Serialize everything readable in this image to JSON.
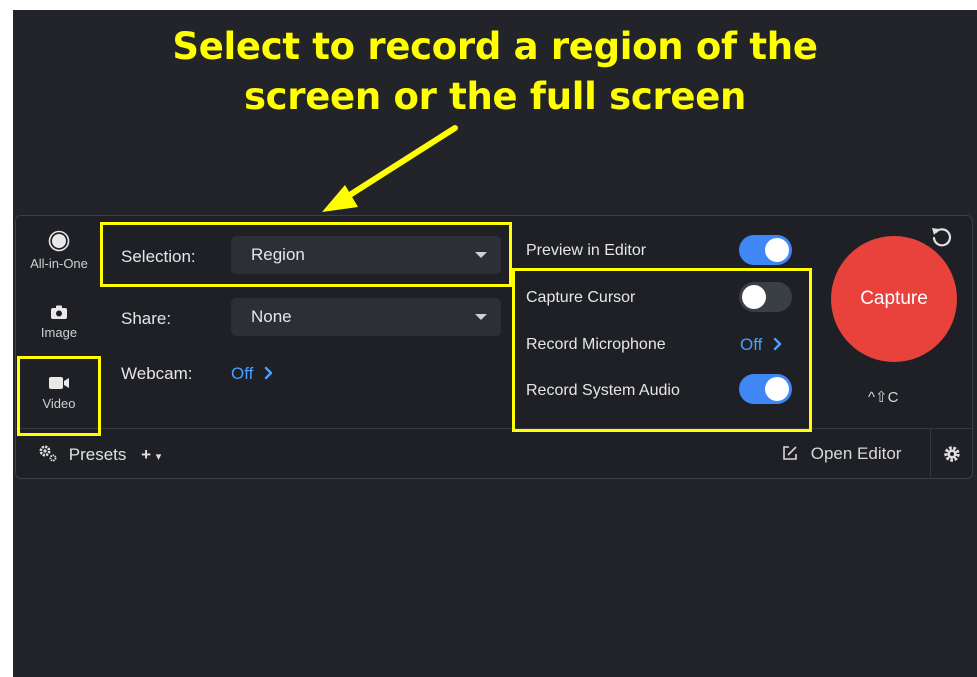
{
  "annotation": {
    "line1": "Select to record a region of the",
    "line2": "screen or the full screen",
    "color": "#ffff00"
  },
  "modes": [
    {
      "label": "All-in-One",
      "icon": "record-circle-icon"
    },
    {
      "label": "Image",
      "icon": "camera-icon"
    },
    {
      "label": "Video",
      "icon": "video-camera-icon"
    }
  ],
  "fields": {
    "selection": {
      "label": "Selection:",
      "value": "Region"
    },
    "share": {
      "label": "Share:",
      "value": "None"
    },
    "webcam": {
      "label": "Webcam:",
      "value": "Off"
    }
  },
  "options": [
    {
      "label": "Preview in Editor",
      "state": "on"
    },
    {
      "label": "Capture Cursor",
      "state": "off"
    },
    {
      "label": "Record Microphone",
      "value": "Off"
    },
    {
      "label": "Record System Audio",
      "state": "on"
    }
  ],
  "capture": {
    "label": "Capture",
    "shortcut": "^⇧C",
    "color": "#e9413c"
  },
  "footer": {
    "presets": "Presets",
    "open_editor": "Open Editor"
  },
  "colors": {
    "accent": "#3e87f5",
    "link": "#4a9fff",
    "panel": "#1e2025"
  }
}
